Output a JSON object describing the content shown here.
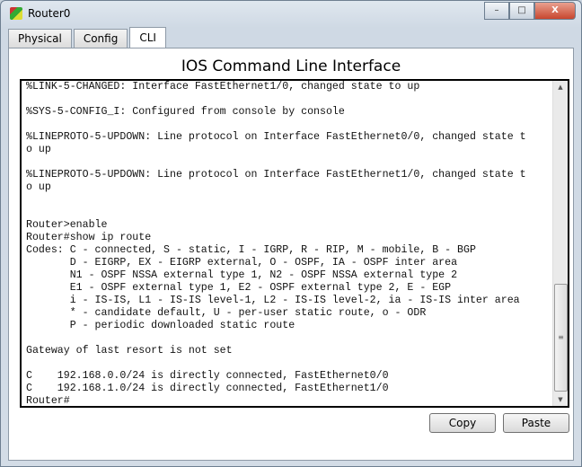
{
  "window": {
    "title": "Router0",
    "controls": {
      "minimize": "–",
      "maximize": "□",
      "close": "X"
    }
  },
  "tabs": [
    {
      "label": "Physical"
    },
    {
      "label": "Config"
    },
    {
      "label": "CLI",
      "active": true
    }
  ],
  "cli": {
    "heading": "IOS Command Line Interface",
    "lines": [
      "%LINK-5-CHANGED: Interface FastEthernet1/0, changed state to up",
      "",
      "%SYS-5-CONFIG_I: Configured from console by console",
      "",
      "%LINEPROTO-5-UPDOWN: Line protocol on Interface FastEthernet0/0, changed state t",
      "o up",
      "",
      "%LINEPROTO-5-UPDOWN: Line protocol on Interface FastEthernet1/0, changed state t",
      "o up",
      "",
      "",
      "Router>enable",
      "Router#show ip route",
      "Codes: C - connected, S - static, I - IGRP, R - RIP, M - mobile, B - BGP",
      "       D - EIGRP, EX - EIGRP external, O - OSPF, IA - OSPF inter area",
      "       N1 - OSPF NSSA external type 1, N2 - OSPF NSSA external type 2",
      "       E1 - OSPF external type 1, E2 - OSPF external type 2, E - EGP",
      "       i - IS-IS, L1 - IS-IS level-1, L2 - IS-IS level-2, ia - IS-IS inter area",
      "       * - candidate default, U - per-user static route, o - ODR",
      "       P - periodic downloaded static route",
      "",
      "Gateway of last resort is not set",
      "",
      "C    192.168.0.0/24 is directly connected, FastEthernet0/0",
      "C    192.168.1.0/24 is directly connected, FastEthernet1/0",
      "Router#"
    ],
    "scroll_position_percent": 100
  },
  "buttons": {
    "copy": "Copy",
    "paste": "Paste"
  }
}
